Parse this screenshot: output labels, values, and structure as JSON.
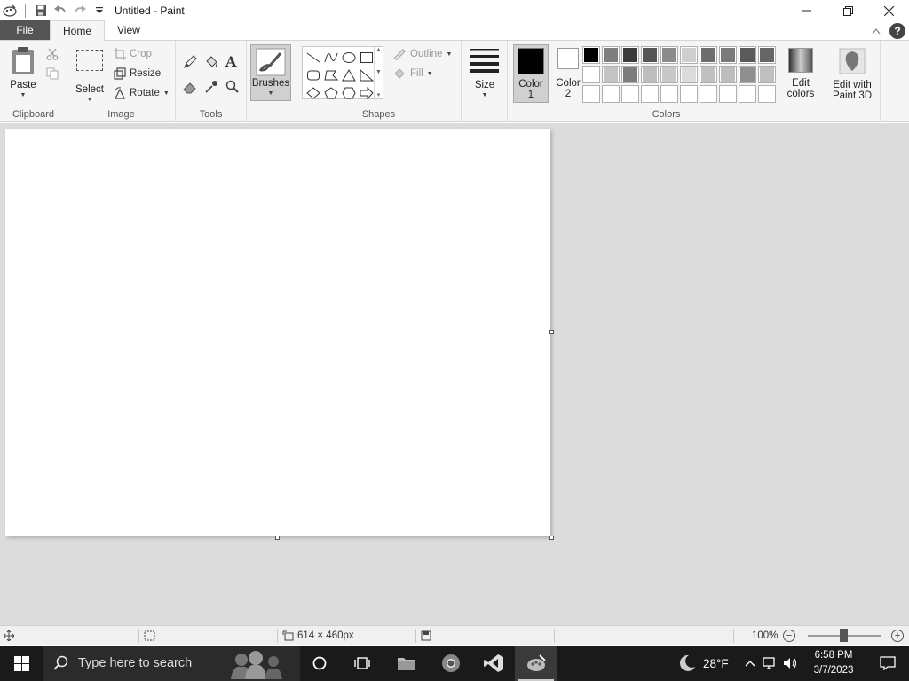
{
  "window": {
    "title": "Untitled - Paint"
  },
  "tabs": [
    {
      "label": "File"
    },
    {
      "label": "Home"
    },
    {
      "label": "View"
    }
  ],
  "ribbon": {
    "clipboard": {
      "label": "Clipboard",
      "paste": "Paste"
    },
    "image": {
      "label": "Image",
      "select": "Select",
      "crop": "Crop",
      "resize": "Resize",
      "rotate": "Rotate"
    },
    "tools": {
      "label": "Tools"
    },
    "brushes": {
      "label": "Brushes"
    },
    "shapes": {
      "label": "Shapes",
      "outline": "Outline",
      "fill": "Fill"
    },
    "size": {
      "label": "Size"
    },
    "colors": {
      "label": "Colors",
      "color1": "Color 1",
      "color1_line1": "Color",
      "color1_line2": "1",
      "color2_line1": "Color",
      "color2_line2": "2",
      "edit_colors_line1": "Edit",
      "edit_colors_line2": "colors",
      "paint3d_line1": "Edit with",
      "paint3d_line2": "Paint 3D",
      "palette_row1": [
        "#000000",
        "#7f7f7f",
        "#3a3a3a",
        "#555555",
        "#8c8c8c",
        "#cfcfcf",
        "#6e6e6e",
        "#7a7a7a",
        "#5a5a5a",
        "#666666"
      ],
      "palette_row2": [
        "#ffffff",
        "#c3c3c3",
        "#7d7d7d",
        "#bdbdbd",
        "#c8c8c8",
        "#dcdcdc",
        "#c0c0c0",
        "#bdbdbd",
        "#8f8f8f",
        "#bfbfbf"
      ],
      "palette_row3": [
        "#ffffff",
        "#ffffff",
        "#ffffff",
        "#ffffff",
        "#ffffff",
        "#ffffff",
        "#ffffff",
        "#ffffff",
        "#ffffff",
        "#ffffff"
      ]
    }
  },
  "status": {
    "canvas_size": "614 × 460px",
    "zoom": "100%"
  },
  "taskbar": {
    "search_placeholder": "Type here to search",
    "temperature": "28°F",
    "time": "6:58 PM",
    "date": "3/7/2023"
  }
}
